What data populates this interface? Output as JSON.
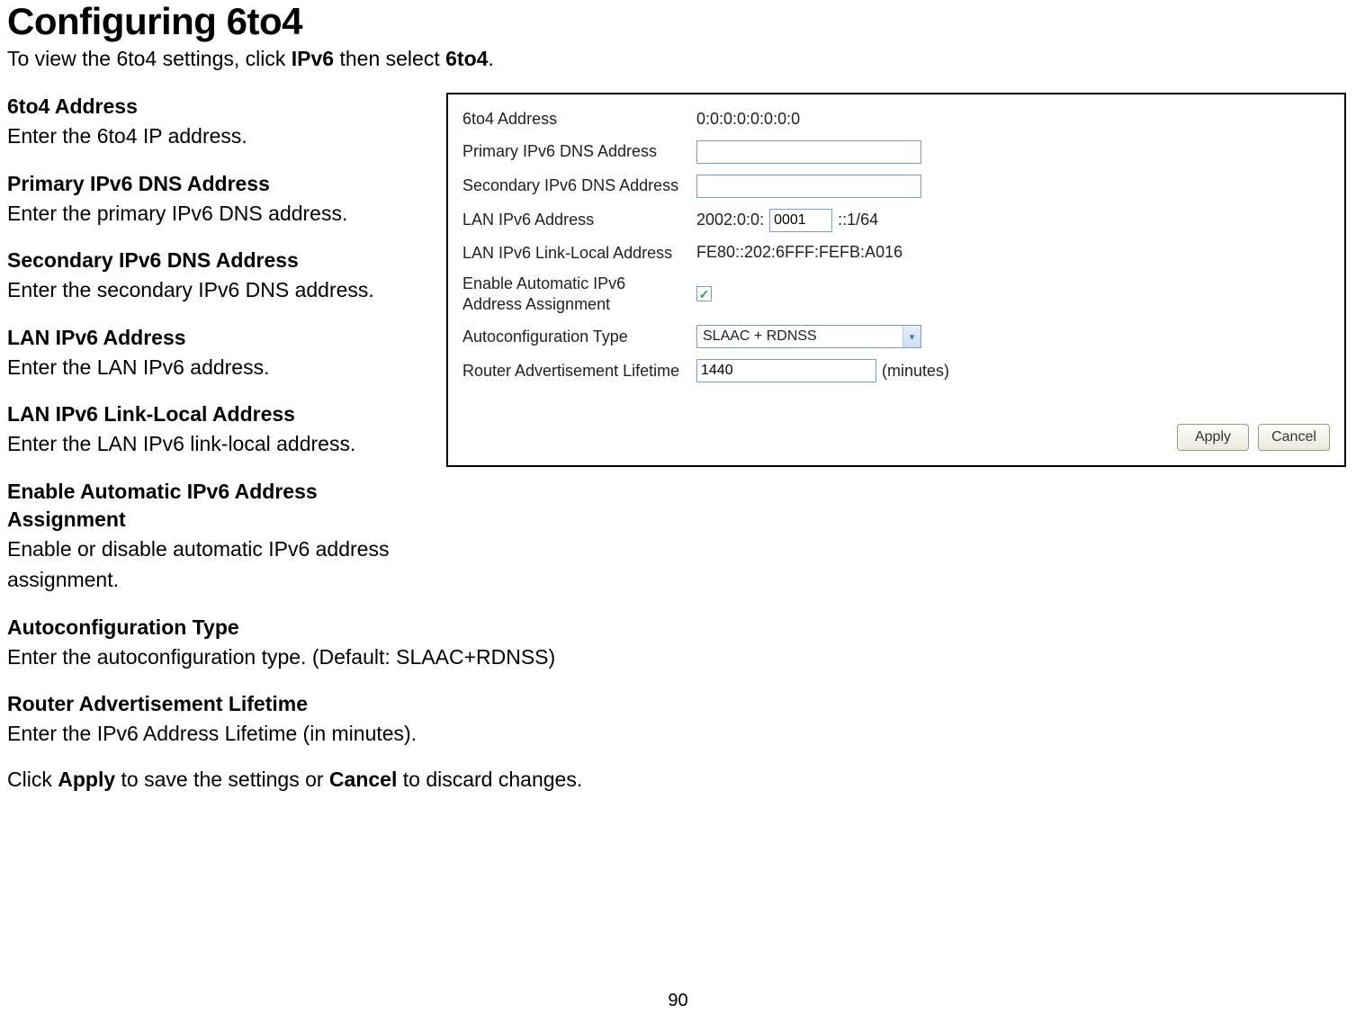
{
  "heading": "Configuring 6to4",
  "intro_pre": "To view the 6to4 settings, click ",
  "intro_link1": "IPv6",
  "intro_mid": " then select ",
  "intro_link2": "6to4",
  "intro_post": ".",
  "defs_left": [
    {
      "term": "6to4 Address",
      "desc": "Enter the 6to4 IP address."
    },
    {
      "term": "Primary IPv6 DNS Address",
      "desc": "Enter the primary IPv6 DNS address."
    },
    {
      "term": "Secondary IPv6 DNS Address",
      "desc": "Enter the secondary IPv6 DNS address."
    },
    {
      "term": "LAN IPv6 Address",
      "desc": "Enter the LAN IPv6 address."
    },
    {
      "term": "LAN IPv6 Link-Local Address",
      "desc": "Enter the LAN IPv6 link-local address."
    },
    {
      "term": "Enable Automatic IPv6 Address Assignment",
      "desc": "Enable or disable automatic IPv6 address assignment."
    }
  ],
  "defs_below": [
    {
      "term": "Autoconfiguration Type",
      "desc": "Enter the autoconfiguration type. (Default: SLAAC+RDNSS)"
    },
    {
      "term": "Router Advertisement Lifetime",
      "desc": "Enter the IPv6 Address Lifetime (in minutes)."
    }
  ],
  "final_pre": "Click ",
  "final_b1": "Apply",
  "final_mid": " to save the settings or ",
  "final_b2": "Cancel",
  "final_post": " to discard changes.",
  "panel": {
    "labels": {
      "sixto4": "6to4 Address",
      "primary_dns": "Primary IPv6 DNS Address",
      "secondary_dns": "Secondary IPv6 DNS Address",
      "lan_ipv6": "LAN IPv6 Address",
      "lan_linklocal": "LAN IPv6 Link-Local Address",
      "enable_auto": "Enable Automatic IPv6 Address Assignment",
      "autoconf_type": "Autoconfiguration Type",
      "router_adv": "Router Advertisement Lifetime"
    },
    "values": {
      "sixto4": "0:0:0:0:0:0:0:0",
      "primary_dns": "",
      "secondary_dns": "",
      "lan_prefix": "2002:0:0:",
      "lan_segment": "0001",
      "lan_suffix": "::1/64",
      "lan_linklocal": "FE80::202:6FFF:FEFB:A016",
      "enable_auto_checked": "✓",
      "autoconf_type": "SLAAC + RDNSS",
      "router_adv": "1440",
      "router_adv_unit": "(minutes)"
    },
    "buttons": {
      "apply": "Apply",
      "cancel": "Cancel"
    }
  },
  "page_number": "90"
}
